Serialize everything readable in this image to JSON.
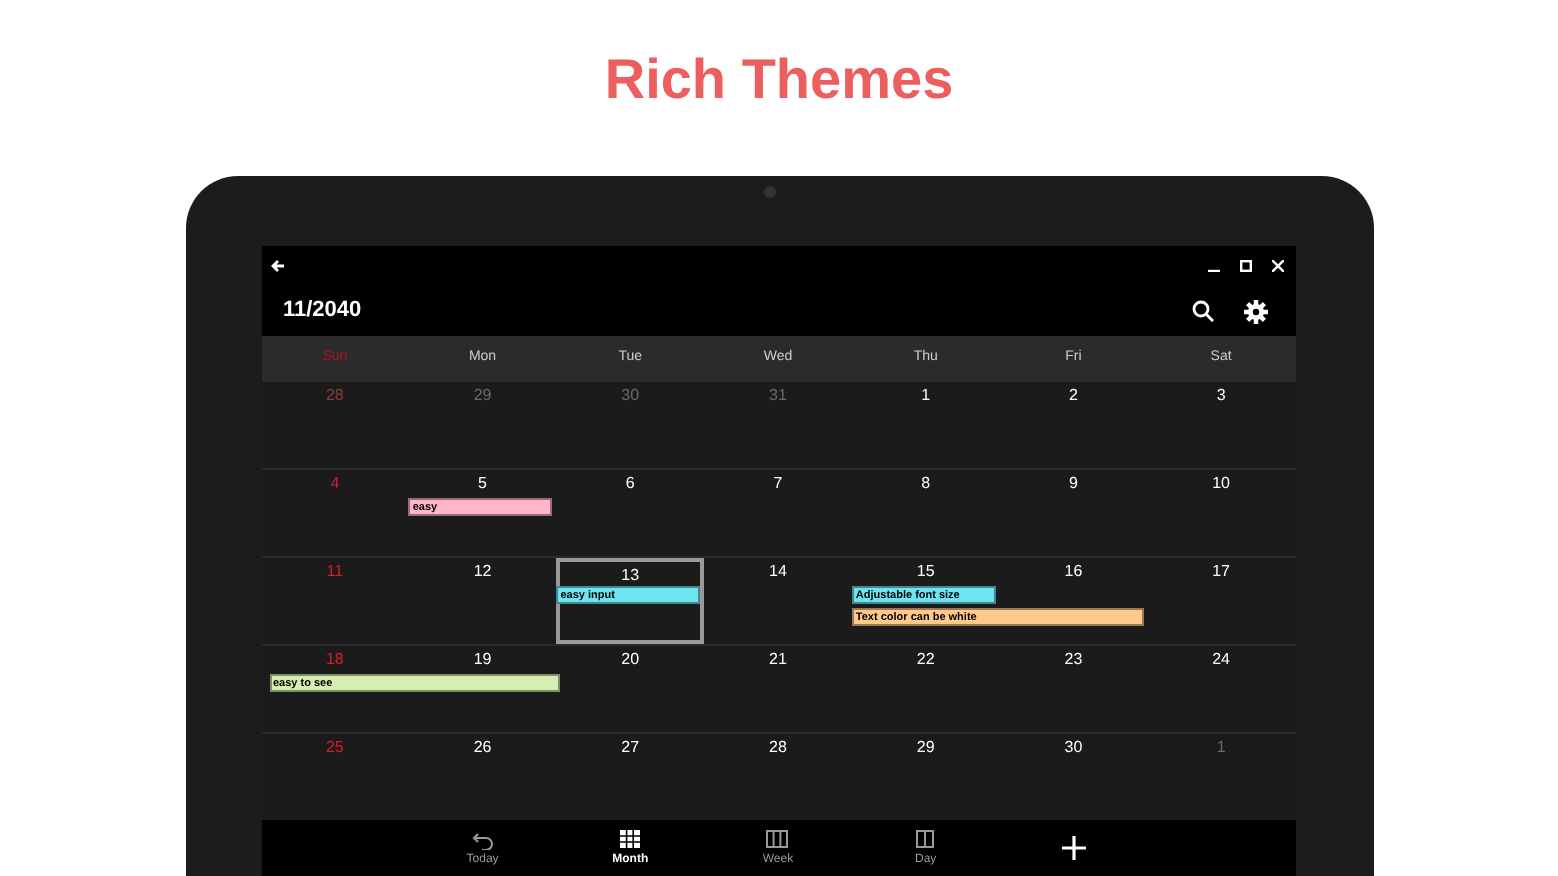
{
  "headline": "Rich Themes",
  "window": {
    "title": "11/2040"
  },
  "weekdays": [
    "Sun",
    "Mon",
    "Tue",
    "Wed",
    "Thu",
    "Fri",
    "Sat"
  ],
  "weeks": [
    {
      "days": [
        {
          "label": "28",
          "in_month": false,
          "selected": false
        },
        {
          "label": "29",
          "in_month": false,
          "selected": false
        },
        {
          "label": "30",
          "in_month": false,
          "selected": false
        },
        {
          "label": "31",
          "in_month": false,
          "selected": false
        },
        {
          "label": "1",
          "in_month": true,
          "selected": false
        },
        {
          "label": "2",
          "in_month": true,
          "selected": false
        },
        {
          "label": "3",
          "in_month": true,
          "selected": false
        }
      ]
    },
    {
      "days": [
        {
          "label": "4",
          "in_month": true,
          "selected": false
        },
        {
          "label": "5",
          "in_month": true,
          "selected": false,
          "events": [
            {
              "title": "easy",
              "color": "#ffb6c8",
              "multi_day": false
            }
          ]
        },
        {
          "label": "6",
          "in_month": true,
          "selected": false
        },
        {
          "label": "7",
          "in_month": true,
          "selected": false
        },
        {
          "label": "8",
          "in_month": true,
          "selected": false
        },
        {
          "label": "9",
          "in_month": true,
          "selected": false
        },
        {
          "label": "10",
          "in_month": true,
          "selected": false
        }
      ]
    },
    {
      "days": [
        {
          "label": "11",
          "in_month": true,
          "selected": false
        },
        {
          "label": "12",
          "in_month": true,
          "selected": false
        },
        {
          "label": "13",
          "in_month": true,
          "selected": true,
          "events": [
            {
              "title": "easy input",
              "color": "#6fe3f0",
              "multi_day": false
            }
          ]
        },
        {
          "label": "14",
          "in_month": true,
          "selected": false
        },
        {
          "label": "15",
          "in_month": true,
          "selected": false,
          "events": [
            {
              "title": "Adjustable font size",
              "color": "#6fe3f0",
              "multi_day": false
            },
            {
              "title": "Text color can be white",
              "color": "#ffc98c",
              "multi_day": true
            }
          ]
        },
        {
          "label": "16",
          "in_month": true,
          "selected": false
        },
        {
          "label": "17",
          "in_month": true,
          "selected": false
        }
      ]
    },
    {
      "days": [
        {
          "label": "18",
          "in_month": true,
          "selected": false,
          "events": [
            {
              "title": "easy to see",
              "color": "#d6efb0",
              "multi_day": true
            }
          ]
        },
        {
          "label": "19",
          "in_month": true,
          "selected": false
        },
        {
          "label": "20",
          "in_month": true,
          "selected": false
        },
        {
          "label": "21",
          "in_month": true,
          "selected": false
        },
        {
          "label": "22",
          "in_month": true,
          "selected": false
        },
        {
          "label": "23",
          "in_month": true,
          "selected": false
        },
        {
          "label": "24",
          "in_month": true,
          "selected": false
        }
      ]
    },
    {
      "days": [
        {
          "label": "25",
          "in_month": true,
          "selected": false
        },
        {
          "label": "26",
          "in_month": true,
          "selected": false
        },
        {
          "label": "27",
          "in_month": true,
          "selected": false
        },
        {
          "label": "28",
          "in_month": true,
          "selected": false
        },
        {
          "label": "29",
          "in_month": true,
          "selected": false
        },
        {
          "label": "30",
          "in_month": true,
          "selected": false
        },
        {
          "label": "1",
          "in_month": false,
          "selected": false
        }
      ]
    }
  ],
  "bottom_nav": [
    {
      "kind": "today",
      "label": "Today",
      "selected": false
    },
    {
      "kind": "month",
      "label": "Month",
      "selected": true
    },
    {
      "kind": "week",
      "label": "Week",
      "selected": false
    },
    {
      "kind": "day",
      "label": "Day",
      "selected": false
    },
    {
      "kind": "add"
    }
  ]
}
